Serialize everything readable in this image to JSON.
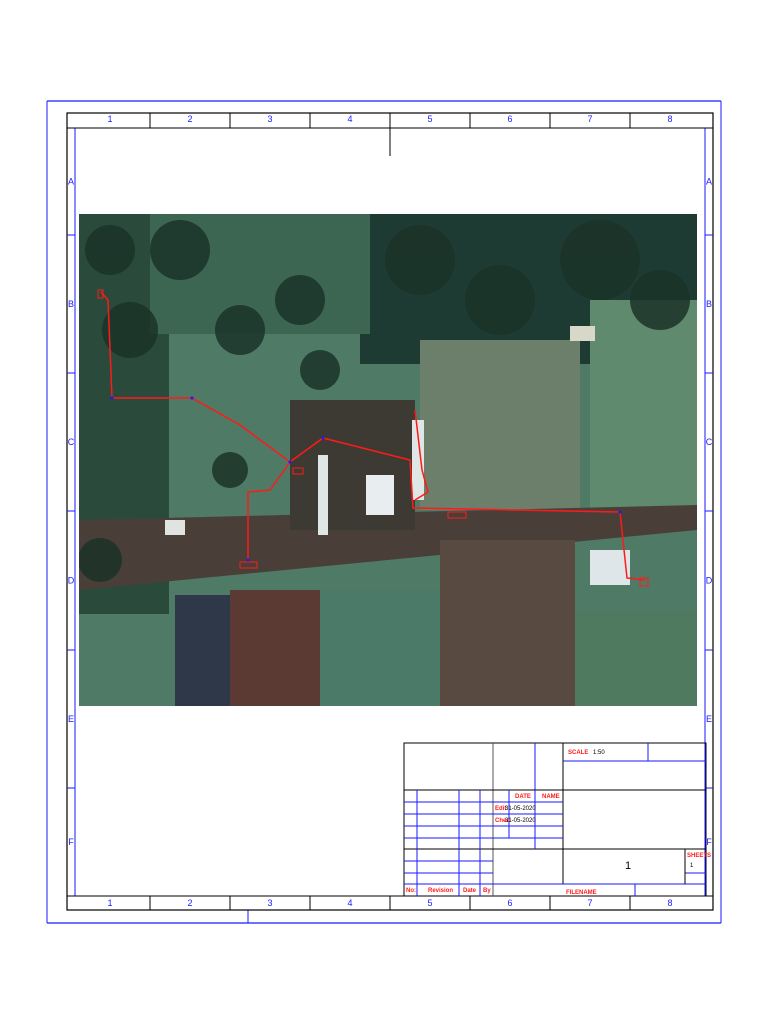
{
  "columns": [
    "1",
    "2",
    "3",
    "4",
    "5",
    "6",
    "7",
    "8"
  ],
  "rows": [
    "A",
    "B",
    "C",
    "D",
    "E",
    "F"
  ],
  "title_block": {
    "scale_label": "SCALE",
    "scale_value": "1:50",
    "date_header": "DATE",
    "name_header": "NAME",
    "edit_label": "Edit",
    "edit_date": "31-05-2020",
    "check_label": "Chec",
    "check_date": "31-05-2020",
    "sheet_number": "1",
    "sheets_label": "SHEETS",
    "sheets_value": "1",
    "revision_headers": [
      "No:",
      "Revision",
      "Date",
      "By"
    ],
    "filename_label": "FILENAME"
  },
  "colors": {
    "frame_blue": "#1a1aff",
    "route_red": "#ff1a1a"
  }
}
